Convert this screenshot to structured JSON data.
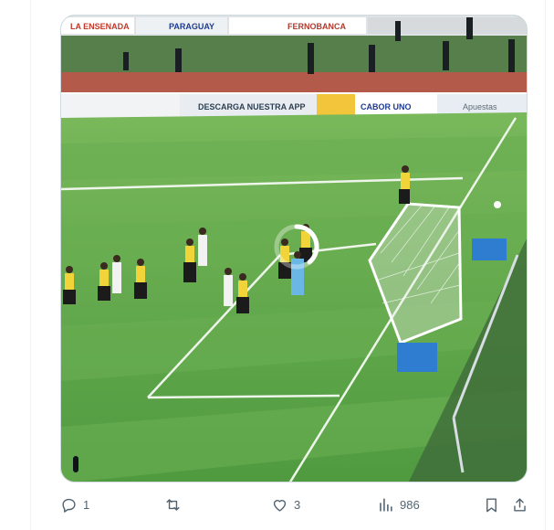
{
  "post": {
    "caption_fragment": "",
    "media": {
      "kind": "video",
      "ads": {
        "la_ensenada": "LA ENSENADA",
        "paraguay": "PARAGUAY",
        "fernobanca": "FERNOBANCA",
        "descarga": "DESCARGA NUESTRA APP",
        "cabor": "CABOR UNO",
        "apuestas": "Apuestas"
      }
    },
    "actions": {
      "reply": {
        "icon": "reply-icon",
        "count": "1"
      },
      "repost": {
        "icon": "repost-icon",
        "count": ""
      },
      "like": {
        "icon": "heart-icon",
        "count": "3"
      },
      "views": {
        "icon": "views-chart-icon",
        "count": "986"
      },
      "bookmark": {
        "icon": "bookmark-icon"
      },
      "share": {
        "icon": "share-icon"
      }
    },
    "colors": {
      "action_gray": "#536471",
      "pitch_green": "#5fa64a"
    }
  }
}
